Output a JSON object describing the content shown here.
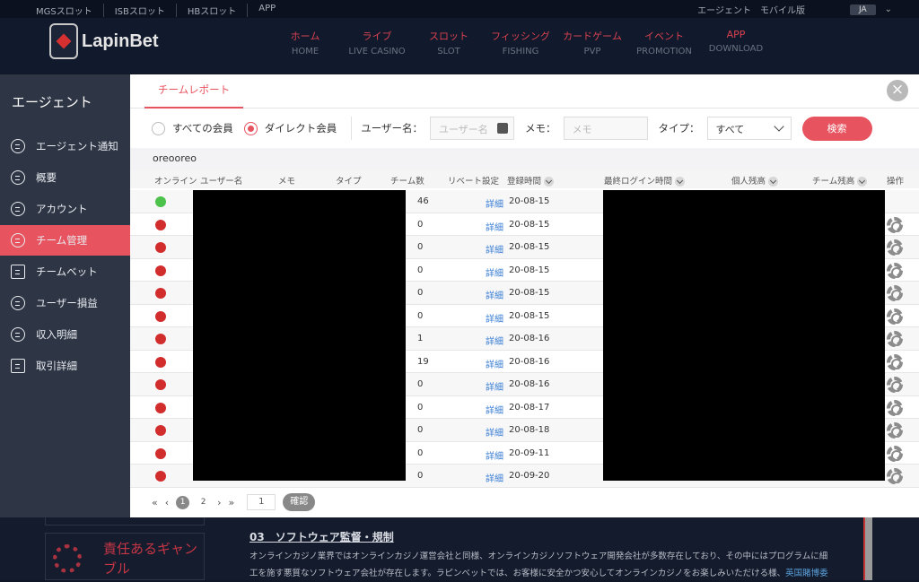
{
  "site": {
    "top_links": [
      "MGSスロット",
      "ISBスロット",
      "HBスロット",
      "APP"
    ],
    "top_right": [
      "エージェント",
      "モバイル版"
    ],
    "lang": "JA",
    "logo_text": "LapinBet",
    "nav": [
      {
        "jp": "ホーム",
        "en": "HOME"
      },
      {
        "jp": "ライブ",
        "en": "LIVE CASINO"
      },
      {
        "jp": "スロット",
        "en": "SLOT"
      },
      {
        "jp": "フィッシング",
        "en": "FISHING"
      },
      {
        "jp": "カードゲーム",
        "en": "PVP"
      },
      {
        "jp": "イベント",
        "en": "PROMOTION"
      },
      {
        "jp": "APP",
        "en": "DOWNLOAD"
      }
    ],
    "promo_box": "責任あるギャンブル",
    "article_title": "03　ソフトウェア監督・規制",
    "article_line1": "オンラインカジノ業界ではオンラインカジノ運営会社と同様、オンラインカジノソフトウェア開発会社が多数存在しており、その中にはプログラムに細",
    "article_line2": "工を施す悪質なソフトウェア会社が存在します。ラピンベットでは、お客様に安全かつ安心してオンラインカジノをお楽しみいただける様、",
    "article_link": "英国賭博委"
  },
  "sidebar": {
    "title": "エージェント",
    "items": [
      {
        "label": "エージェント通知",
        "icon": "notice-icon"
      },
      {
        "label": "概要",
        "icon": "chart-icon"
      },
      {
        "label": "アカウント",
        "icon": "link-icon"
      },
      {
        "label": "チーム管理",
        "icon": "user-icon"
      },
      {
        "label": "チームベット",
        "icon": "wallet-icon"
      },
      {
        "label": "ユーザー損益",
        "icon": "list-icon"
      },
      {
        "label": "収入明細",
        "icon": "ledger-icon"
      },
      {
        "label": "取引詳細",
        "icon": "clipboard-icon"
      }
    ]
  },
  "panel": {
    "tab": "チームレポート",
    "filters": {
      "radio_all": "すべての会員",
      "radio_direct": "ダイレクト会員",
      "username_label": "ユーザー名：",
      "username_placeholder": "ユーザー名",
      "memo_label": "メモ：",
      "memo_placeholder": "メモ",
      "type_label": "タイプ：",
      "type_value": "すべて",
      "search": "検索"
    },
    "breadcrumb": "oreooreo",
    "columns": {
      "online": "オンライン",
      "username": "ユーザー名",
      "memo": "メモ",
      "type": "タイプ",
      "team_count": "チーム数",
      "rebate": "リベート設定",
      "registered": "登録時間",
      "last_login": "最終ログイン時間",
      "balance": "個人残高",
      "team_balance": "チーム残高",
      "action": "操作"
    },
    "rows": [
      {
        "online": true,
        "count": "46",
        "rebate": "詳細",
        "date": "20-08-15"
      },
      {
        "online": false,
        "count": "0",
        "rebate": "詳細",
        "date": "20-08-15"
      },
      {
        "online": false,
        "count": "0",
        "rebate": "詳細",
        "date": "20-08-15"
      },
      {
        "online": false,
        "count": "0",
        "rebate": "詳細",
        "date": "20-08-15"
      },
      {
        "online": false,
        "count": "0",
        "rebate": "詳細",
        "date": "20-08-15"
      },
      {
        "online": false,
        "count": "0",
        "rebate": "詳細",
        "date": "20-08-15"
      },
      {
        "online": false,
        "count": "1",
        "rebate": "詳細",
        "date": "20-08-16"
      },
      {
        "online": false,
        "count": "19",
        "rebate": "詳細",
        "date": "20-08-16"
      },
      {
        "online": false,
        "count": "0",
        "rebate": "詳細",
        "date": "20-08-16"
      },
      {
        "online": false,
        "count": "0",
        "rebate": "詳細",
        "date": "20-08-17"
      },
      {
        "online": false,
        "count": "0",
        "rebate": "詳細",
        "date": "20-08-18"
      },
      {
        "online": false,
        "count": "0",
        "rebate": "詳細",
        "date": "20-09-11"
      },
      {
        "online": false,
        "count": "0",
        "rebate": "詳細",
        "date": "20-09-20"
      }
    ],
    "pager": {
      "first": "«",
      "prev": "‹",
      "next": "›",
      "last": "»",
      "pages": [
        "1",
        "2"
      ],
      "current": "1",
      "goto_value": "1",
      "confirm": "確認"
    },
    "colors": {
      "accent": "#e7535f",
      "online": "#4cc24a",
      "offline": "#d22d2d",
      "link": "#3b7fd4"
    }
  }
}
